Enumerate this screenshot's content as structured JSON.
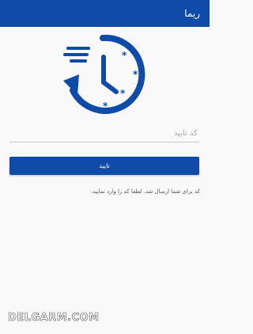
{
  "appbar": {
    "title": "ریما"
  },
  "logo": {
    "icon": "clock-refresh-icon",
    "color": "#0f4ba8"
  },
  "form": {
    "code_placeholder": "کد تایید",
    "code_value": "",
    "confirm_label": "تایید"
  },
  "info": {
    "message": "کد برای شما ارسال شد. لطفا کد را وارد نمایید."
  },
  "watermark": {
    "text": "DELGARM.COM"
  },
  "colors": {
    "primary": "#0f4ba8",
    "background": "#f9f9f9"
  }
}
